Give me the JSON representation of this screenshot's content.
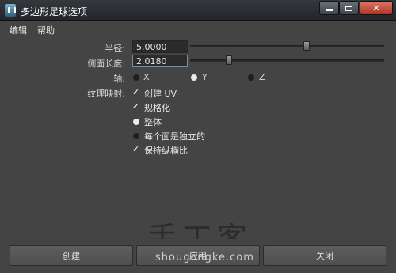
{
  "window": {
    "title": "多边形足球选项",
    "controls": {
      "close_label": "✕"
    }
  },
  "menu": {
    "items": [
      "编辑",
      "帮助"
    ]
  },
  "form": {
    "radius": {
      "label": "半径:",
      "value": "5.0000",
      "slider_fraction": 0.6
    },
    "side_length": {
      "label": "侧面长度:",
      "value": "2.0180",
      "slider_fraction": 0.2
    },
    "axis": {
      "label": "轴:",
      "options": [
        "X",
        "Y",
        "Z"
      ],
      "selected": "Y"
    },
    "texture_mapping": {
      "label": "纹理映射:",
      "create_uv": {
        "label": "创建 UV",
        "checked": true
      },
      "normalize": {
        "label": "规格化",
        "checked": true
      },
      "mode_options": [
        "整体",
        "每个面是独立的"
      ],
      "mode_selected": "整体",
      "preserve_aspect": {
        "label": "保持纵横比",
        "checked": true
      }
    }
  },
  "watermark": {
    "cn": "手工客",
    "en": "shougongke.com"
  },
  "buttons": {
    "create": "创建",
    "apply": "应用",
    "close": "关闭"
  },
  "colors": {
    "title_bg": "#2b2e33",
    "close_button": "#c44a36",
    "panel_bg": "#444444"
  }
}
